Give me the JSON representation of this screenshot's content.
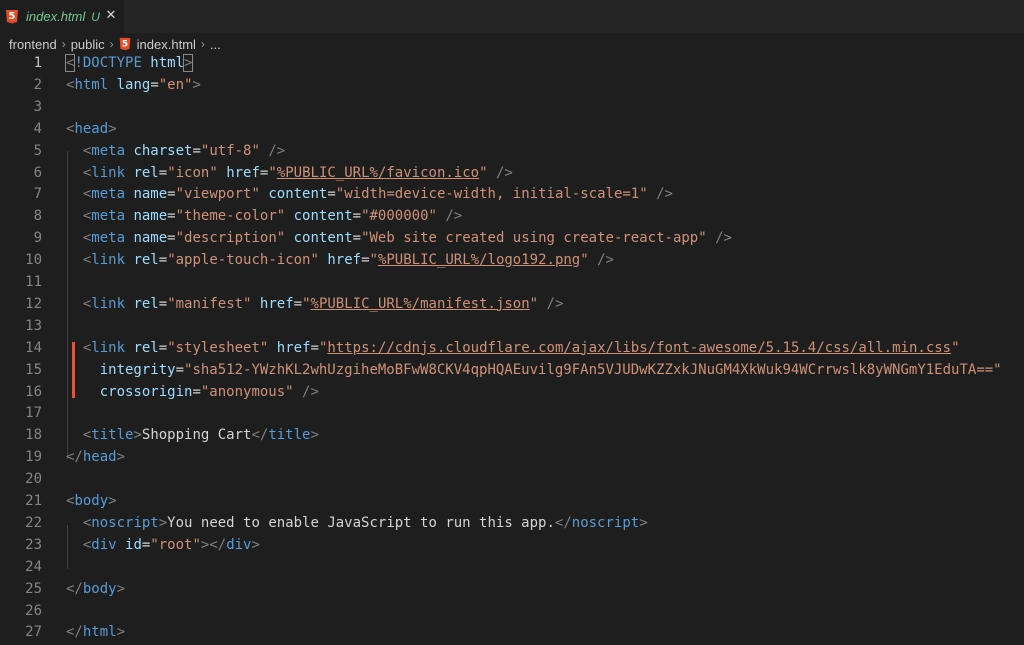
{
  "tab": {
    "icon": "html5-icon",
    "label": "index.html",
    "badge": "U",
    "close": "✕"
  },
  "breadcrumb": [
    "frontend",
    "public",
    "index.html",
    "..."
  ],
  "colors": {
    "background": "#1e1e1e",
    "tag": "#569cd6",
    "attribute": "#9cdcfe",
    "string": "#ce9178",
    "text": "#d4d4d4",
    "line_number": "#858585",
    "modified_marker": "#e2553b"
  },
  "active_line": 1,
  "lines": [
    {
      "n": "1",
      "tokens": [
        {
          "t": "<",
          "c": "punct",
          "box": true
        },
        {
          "t": "!DOCTYPE ",
          "c": "tag"
        },
        {
          "t": "html",
          "c": "attr"
        },
        {
          "t": ">",
          "c": "punct",
          "box": true
        }
      ]
    },
    {
      "n": "2",
      "tokens": [
        {
          "t": "<",
          "c": "punct"
        },
        {
          "t": "html",
          "c": "tag"
        },
        {
          "t": " ",
          "c": "text"
        },
        {
          "t": "lang",
          "c": "attr"
        },
        {
          "t": "=",
          "c": "text"
        },
        {
          "t": "\"en\"",
          "c": "str"
        },
        {
          "t": ">",
          "c": "punct"
        }
      ]
    },
    {
      "n": "3",
      "tokens": []
    },
    {
      "n": "4",
      "tokens": [
        {
          "t": "<",
          "c": "punct"
        },
        {
          "t": "head",
          "c": "tag"
        },
        {
          "t": ">",
          "c": "punct"
        }
      ]
    },
    {
      "n": "5",
      "tokens": [
        {
          "t": "  ",
          "c": "text"
        },
        {
          "t": "<",
          "c": "punct"
        },
        {
          "t": "meta",
          "c": "tag"
        },
        {
          "t": " ",
          "c": "text"
        },
        {
          "t": "charset",
          "c": "attr"
        },
        {
          "t": "=",
          "c": "text"
        },
        {
          "t": "\"utf-8\"",
          "c": "str"
        },
        {
          "t": " />",
          "c": "punct"
        }
      ]
    },
    {
      "n": "6",
      "tokens": [
        {
          "t": "  ",
          "c": "text"
        },
        {
          "t": "<",
          "c": "punct"
        },
        {
          "t": "link",
          "c": "tag"
        },
        {
          "t": " ",
          "c": "text"
        },
        {
          "t": "rel",
          "c": "attr"
        },
        {
          "t": "=",
          "c": "text"
        },
        {
          "t": "\"icon\"",
          "c": "str"
        },
        {
          "t": " ",
          "c": "text"
        },
        {
          "t": "href",
          "c": "attr"
        },
        {
          "t": "=",
          "c": "text"
        },
        {
          "t": "\"",
          "c": "str"
        },
        {
          "t": "%PUBLIC_URL%/favicon.ico",
          "c": "link"
        },
        {
          "t": "\"",
          "c": "str"
        },
        {
          "t": " />",
          "c": "punct"
        }
      ]
    },
    {
      "n": "7",
      "tokens": [
        {
          "t": "  ",
          "c": "text"
        },
        {
          "t": "<",
          "c": "punct"
        },
        {
          "t": "meta",
          "c": "tag"
        },
        {
          "t": " ",
          "c": "text"
        },
        {
          "t": "name",
          "c": "attr"
        },
        {
          "t": "=",
          "c": "text"
        },
        {
          "t": "\"viewport\"",
          "c": "str"
        },
        {
          "t": " ",
          "c": "text"
        },
        {
          "t": "content",
          "c": "attr"
        },
        {
          "t": "=",
          "c": "text"
        },
        {
          "t": "\"width=device-width, initial-scale=1\"",
          "c": "str"
        },
        {
          "t": " />",
          "c": "punct"
        }
      ]
    },
    {
      "n": "8",
      "tokens": [
        {
          "t": "  ",
          "c": "text"
        },
        {
          "t": "<",
          "c": "punct"
        },
        {
          "t": "meta",
          "c": "tag"
        },
        {
          "t": " ",
          "c": "text"
        },
        {
          "t": "name",
          "c": "attr"
        },
        {
          "t": "=",
          "c": "text"
        },
        {
          "t": "\"theme-color\"",
          "c": "str"
        },
        {
          "t": " ",
          "c": "text"
        },
        {
          "t": "content",
          "c": "attr"
        },
        {
          "t": "=",
          "c": "text"
        },
        {
          "t": "\"#000000\"",
          "c": "str"
        },
        {
          "t": " />",
          "c": "punct"
        }
      ]
    },
    {
      "n": "9",
      "tokens": [
        {
          "t": "  ",
          "c": "text"
        },
        {
          "t": "<",
          "c": "punct"
        },
        {
          "t": "meta",
          "c": "tag"
        },
        {
          "t": " ",
          "c": "text"
        },
        {
          "t": "name",
          "c": "attr"
        },
        {
          "t": "=",
          "c": "text"
        },
        {
          "t": "\"description\"",
          "c": "str"
        },
        {
          "t": " ",
          "c": "text"
        },
        {
          "t": "content",
          "c": "attr"
        },
        {
          "t": "=",
          "c": "text"
        },
        {
          "t": "\"Web site created using create-react-app\"",
          "c": "str"
        },
        {
          "t": " />",
          "c": "punct"
        }
      ]
    },
    {
      "n": "10",
      "tokens": [
        {
          "t": "  ",
          "c": "text"
        },
        {
          "t": "<",
          "c": "punct"
        },
        {
          "t": "link",
          "c": "tag"
        },
        {
          "t": " ",
          "c": "text"
        },
        {
          "t": "rel",
          "c": "attr"
        },
        {
          "t": "=",
          "c": "text"
        },
        {
          "t": "\"apple-touch-icon\"",
          "c": "str"
        },
        {
          "t": " ",
          "c": "text"
        },
        {
          "t": "href",
          "c": "attr"
        },
        {
          "t": "=",
          "c": "text"
        },
        {
          "t": "\"",
          "c": "str"
        },
        {
          "t": "%PUBLIC_URL%/logo192.png",
          "c": "link"
        },
        {
          "t": "\"",
          "c": "str"
        },
        {
          "t": " />",
          "c": "punct"
        }
      ]
    },
    {
      "n": "11",
      "tokens": []
    },
    {
      "n": "12",
      "tokens": [
        {
          "t": "  ",
          "c": "text"
        },
        {
          "t": "<",
          "c": "punct"
        },
        {
          "t": "link",
          "c": "tag"
        },
        {
          "t": " ",
          "c": "text"
        },
        {
          "t": "rel",
          "c": "attr"
        },
        {
          "t": "=",
          "c": "text"
        },
        {
          "t": "\"manifest\"",
          "c": "str"
        },
        {
          "t": " ",
          "c": "text"
        },
        {
          "t": "href",
          "c": "attr"
        },
        {
          "t": "=",
          "c": "text"
        },
        {
          "t": "\"",
          "c": "str"
        },
        {
          "t": "%PUBLIC_URL%/manifest.json",
          "c": "link"
        },
        {
          "t": "\"",
          "c": "str"
        },
        {
          "t": " />",
          "c": "punct"
        }
      ]
    },
    {
      "n": "13",
      "tokens": []
    },
    {
      "n": "14",
      "tokens": [
        {
          "t": "  ",
          "c": "text"
        },
        {
          "t": "<",
          "c": "punct"
        },
        {
          "t": "link",
          "c": "tag"
        },
        {
          "t": " ",
          "c": "text"
        },
        {
          "t": "rel",
          "c": "attr"
        },
        {
          "t": "=",
          "c": "text"
        },
        {
          "t": "\"stylesheet\"",
          "c": "str"
        },
        {
          "t": " ",
          "c": "text"
        },
        {
          "t": "href",
          "c": "attr"
        },
        {
          "t": "=",
          "c": "text"
        },
        {
          "t": "\"",
          "c": "str"
        },
        {
          "t": "https://cdnjs.cloudflare.com/ajax/libs/font-awesome/5.15.4/css/all.min.css",
          "c": "link"
        },
        {
          "t": "\"",
          "c": "str"
        }
      ]
    },
    {
      "n": "15",
      "tokens": [
        {
          "t": "    ",
          "c": "text"
        },
        {
          "t": "integrity",
          "c": "attr"
        },
        {
          "t": "=",
          "c": "text"
        },
        {
          "t": "\"sha512-YWzhKL2whUzgiheMoBFwW8CKV4qpHQAEuvilg9FAn5VJUDwKZZxkJNuGM4XkWuk94WCrrwslk8yWNGmY1EduTA==\"",
          "c": "str"
        }
      ]
    },
    {
      "n": "16",
      "tokens": [
        {
          "t": "    ",
          "c": "text"
        },
        {
          "t": "crossorigin",
          "c": "attr"
        },
        {
          "t": "=",
          "c": "text"
        },
        {
          "t": "\"anonymous\"",
          "c": "str"
        },
        {
          "t": " />",
          "c": "punct"
        }
      ]
    },
    {
      "n": "17",
      "tokens": []
    },
    {
      "n": "18",
      "tokens": [
        {
          "t": "  ",
          "c": "text"
        },
        {
          "t": "<",
          "c": "punct"
        },
        {
          "t": "title",
          "c": "tag"
        },
        {
          "t": ">",
          "c": "punct"
        },
        {
          "t": "Shopping Cart",
          "c": "text"
        },
        {
          "t": "</",
          "c": "punct"
        },
        {
          "t": "title",
          "c": "tag"
        },
        {
          "t": ">",
          "c": "punct"
        }
      ]
    },
    {
      "n": "19",
      "tokens": [
        {
          "t": "</",
          "c": "punct"
        },
        {
          "t": "head",
          "c": "tag"
        },
        {
          "t": ">",
          "c": "punct"
        }
      ]
    },
    {
      "n": "20",
      "tokens": []
    },
    {
      "n": "21",
      "tokens": [
        {
          "t": "<",
          "c": "punct"
        },
        {
          "t": "body",
          "c": "tag"
        },
        {
          "t": ">",
          "c": "punct"
        }
      ]
    },
    {
      "n": "22",
      "tokens": [
        {
          "t": "  ",
          "c": "text"
        },
        {
          "t": "<",
          "c": "punct"
        },
        {
          "t": "noscript",
          "c": "tag"
        },
        {
          "t": ">",
          "c": "punct"
        },
        {
          "t": "You need to enable JavaScript to run this app.",
          "c": "text"
        },
        {
          "t": "</",
          "c": "punct"
        },
        {
          "t": "noscript",
          "c": "tag"
        },
        {
          "t": ">",
          "c": "punct"
        }
      ]
    },
    {
      "n": "23",
      "tokens": [
        {
          "t": "  ",
          "c": "text"
        },
        {
          "t": "<",
          "c": "punct"
        },
        {
          "t": "div",
          "c": "tag"
        },
        {
          "t": " ",
          "c": "text"
        },
        {
          "t": "id",
          "c": "attr"
        },
        {
          "t": "=",
          "c": "text"
        },
        {
          "t": "\"root\"",
          "c": "str"
        },
        {
          "t": "></",
          "c": "punct"
        },
        {
          "t": "div",
          "c": "tag"
        },
        {
          "t": ">",
          "c": "punct"
        }
      ]
    },
    {
      "n": "24",
      "tokens": []
    },
    {
      "n": "25",
      "tokens": [
        {
          "t": "</",
          "c": "punct"
        },
        {
          "t": "body",
          "c": "tag"
        },
        {
          "t": ">",
          "c": "punct"
        }
      ]
    },
    {
      "n": "26",
      "tokens": []
    },
    {
      "n": "27",
      "tokens": [
        {
          "t": "</",
          "c": "punct"
        },
        {
          "t": "html",
          "c": "tag"
        },
        {
          "t": ">",
          "c": "punct"
        }
      ]
    }
  ]
}
